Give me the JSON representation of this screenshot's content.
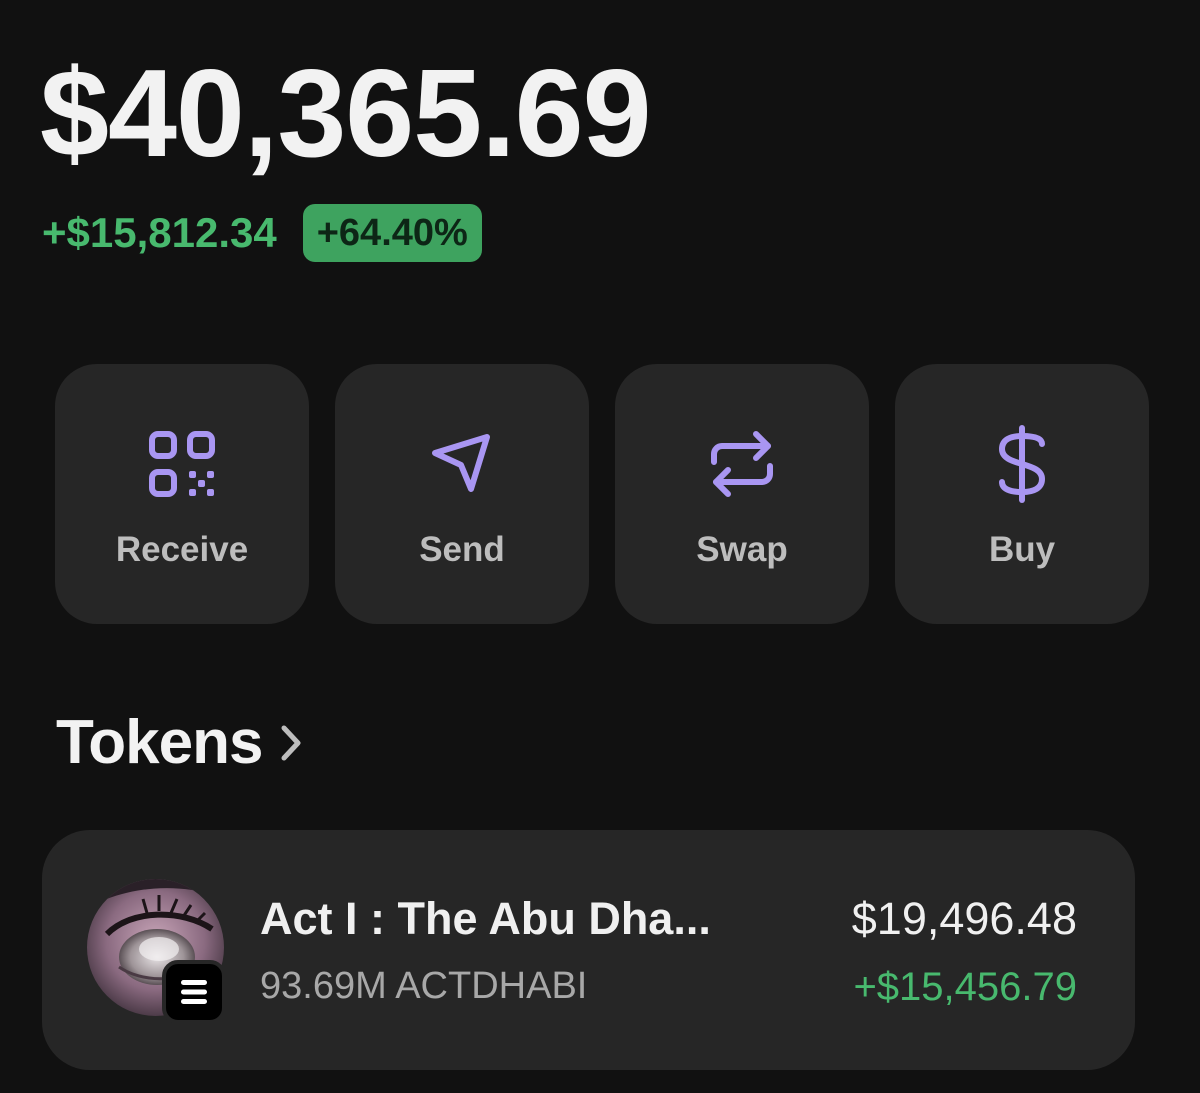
{
  "portfolio": {
    "balance": "$40,365.69",
    "change_amount": "+$15,812.34",
    "change_percent": "+64.40%"
  },
  "actions": [
    {
      "label": "Receive",
      "icon": "qr-code-icon"
    },
    {
      "label": "Send",
      "icon": "send-arrow-icon"
    },
    {
      "label": "Swap",
      "icon": "swap-arrows-icon"
    },
    {
      "label": "Buy",
      "icon": "dollar-icon"
    }
  ],
  "tokens_section": {
    "title": "Tokens",
    "icon": "chevron-right-icon"
  },
  "tokens": [
    {
      "name": "Act I : The Abu Dha...",
      "amount": "93.69M ACTDHABI",
      "value": "$19,496.48",
      "change": "+$15,456.79",
      "chain_icon": "solana-icon"
    }
  ],
  "colors": {
    "background": "#111111",
    "card": "#262626",
    "accent": "#a996f2",
    "positive": "#48b96e",
    "badge": "#3ea35f"
  }
}
